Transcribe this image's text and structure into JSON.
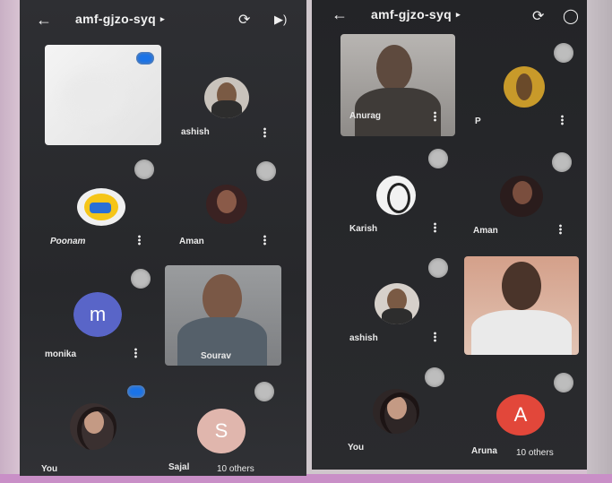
{
  "colors": {
    "panel_bg": "#2a2b2e",
    "monika_avatar": "#5965c8",
    "sajal_avatar": "#e0b6ad",
    "aruna_avatar": "#e2473a",
    "mic_badge": "#1a73e8"
  },
  "left": {
    "topbar": {
      "title": "amf-gjzo-syq",
      "back_icon": "arrow-left",
      "camera_icon": "switch-camera",
      "audio_icon": "speaker"
    },
    "participants": [
      {
        "name": "ashish"
      },
      {
        "name": "Poonam"
      },
      {
        "name": "Aman"
      },
      {
        "name": "monika",
        "initial": "m"
      },
      {
        "name": "Sourav"
      },
      {
        "name": "You"
      },
      {
        "name": "Sajal",
        "initial": "S"
      }
    ],
    "others_label": "10 others"
  },
  "right": {
    "topbar": {
      "title": "amf-gjzo-syq",
      "back_icon": "arrow-left",
      "camera_icon": "switch-camera",
      "audio_icon": "headphones"
    },
    "participants": [
      {
        "name": "Anurag"
      },
      {
        "name": "P"
      },
      {
        "name": "Karish"
      },
      {
        "name": "Aman"
      },
      {
        "name": "ashish"
      },
      {
        "name": "You"
      },
      {
        "name": "Aruna",
        "initial": "A"
      }
    ],
    "others_label": "10 others"
  }
}
